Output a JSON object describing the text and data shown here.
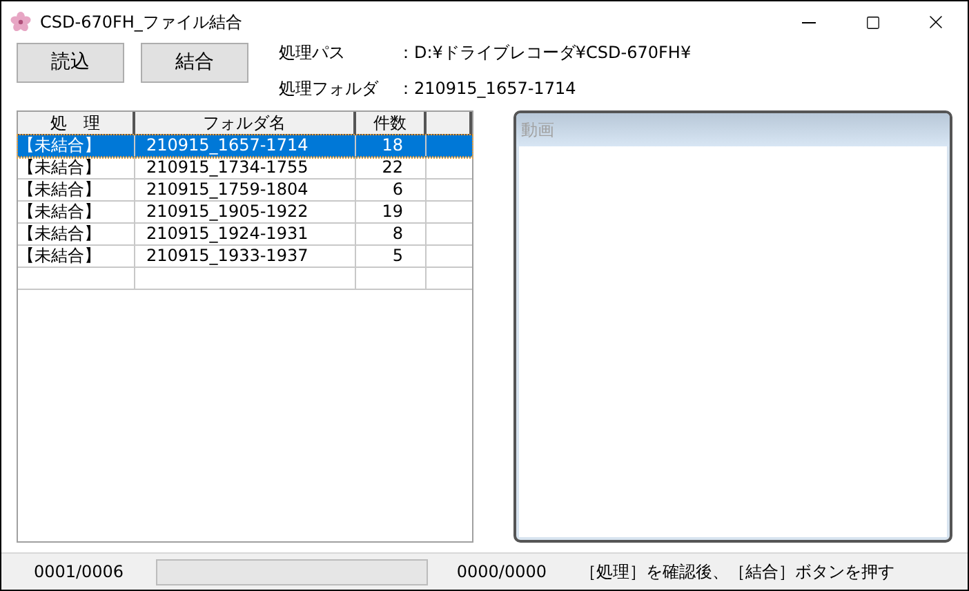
{
  "window": {
    "title": "CSD-670FH_ファイル結合"
  },
  "buttons": [
    "読込",
    "結合"
  ],
  "info": [
    {
      "label": "処理パス",
      "value": "：D:¥ドライブレコーダ¥CSD-670FH¥"
    },
    {
      "label": "処理フォルダ",
      "value": "：210915_1657-1714"
    }
  ],
  "table": {
    "columns": [
      "処　理",
      "フォルダ名",
      "件数"
    ],
    "rows": [
      {
        "status": "【未結合】",
        "folder": "210915_1657-1714",
        "count": "18",
        "selected": true
      },
      {
        "status": "【未結合】",
        "folder": "210915_1734-1755",
        "count": "22",
        "selected": false
      },
      {
        "status": "【未結合】",
        "folder": "210915_1759-1804",
        "count": "6",
        "selected": false
      },
      {
        "status": "【未結合】",
        "folder": "210915_1905-1922",
        "count": "19",
        "selected": false
      },
      {
        "status": "【未結合】",
        "folder": "210915_1924-1931",
        "count": "8",
        "selected": false
      },
      {
        "status": "【未結合】",
        "folder": "210915_1933-1937",
        "count": "5",
        "selected": false
      }
    ]
  },
  "video_panel": {
    "title": "動画"
  },
  "status_bar": {
    "position": "0001/0006",
    "progress": {
      "level": 0
    },
    "progress_count": "0000/0000",
    "message": "［処理］を確認後、［結合］ボタンを押す"
  }
}
